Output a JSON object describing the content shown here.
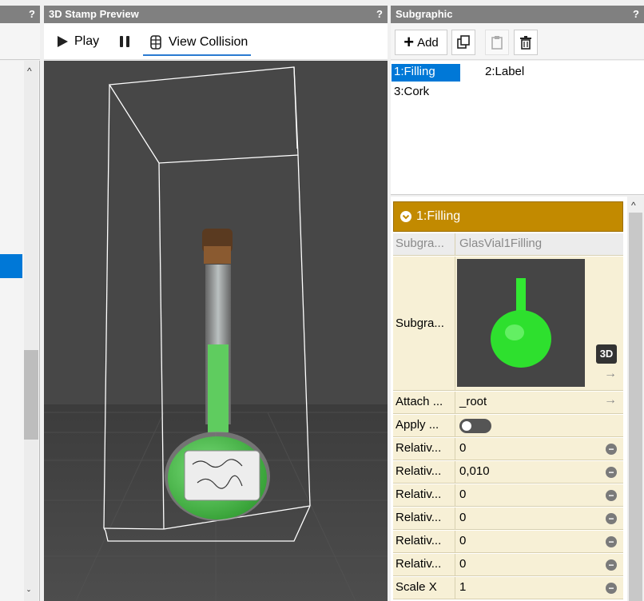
{
  "left": {
    "help": "?"
  },
  "preview": {
    "title": "3D Stamp Preview",
    "help": "?",
    "play_label": "Play",
    "view_collision_label": "View Collision"
  },
  "subgraphic": {
    "title": "Subgraphic",
    "help": "?",
    "add_label": "Add",
    "items": [
      "1:Filling",
      "2:Label",
      "3:Cork"
    ]
  },
  "properties": {
    "header": "1:Filling",
    "rows": [
      {
        "key": "Subgra...",
        "value": "GlasVial1Filling"
      },
      {
        "key": "Subgra...",
        "value": ""
      },
      {
        "key": "Attach ...",
        "value": "_root"
      },
      {
        "key": "Apply ...",
        "value": ""
      },
      {
        "key": "Relativ...",
        "value": "0"
      },
      {
        "key": "Relativ...",
        "value": "0,010"
      },
      {
        "key": "Relativ...",
        "value": "0"
      },
      {
        "key": "Relativ...",
        "value": "0"
      },
      {
        "key": "Relativ...",
        "value": "0"
      },
      {
        "key": "Relativ...",
        "value": "0"
      },
      {
        "key": "Scale X",
        "value": "1"
      }
    ],
    "badge_3d": "3D",
    "minus_glyph": "−",
    "arrow_glyph": "→"
  }
}
